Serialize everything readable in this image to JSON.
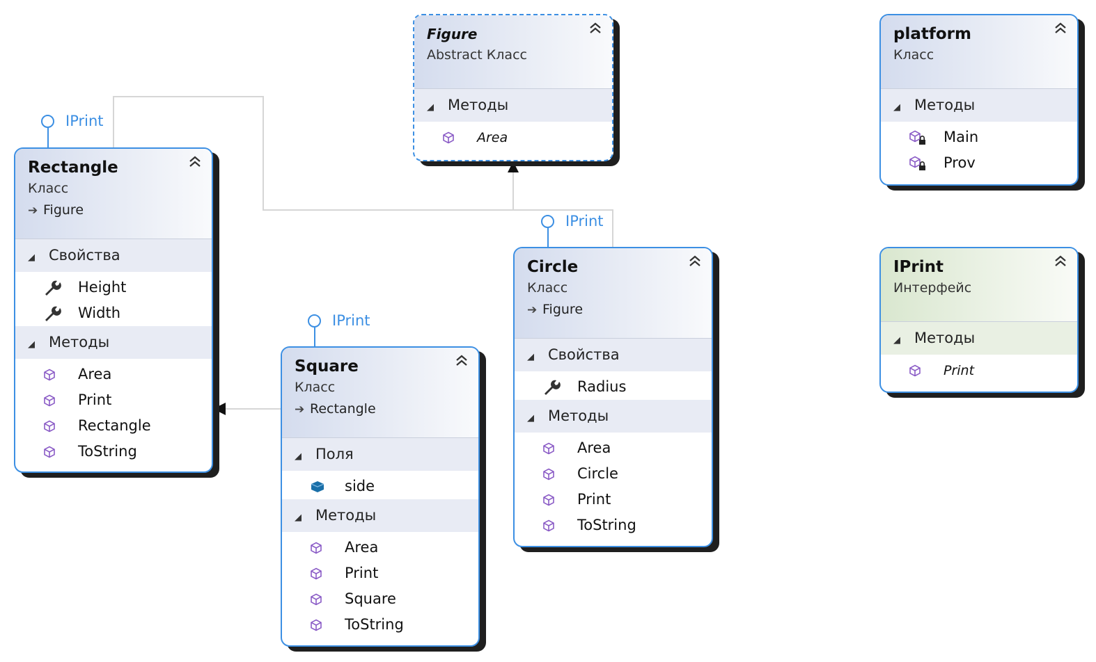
{
  "colors": {
    "accent": "#3c8fe3",
    "shadow": "#1f1f1f",
    "class_header": "#d4dcee",
    "interface_header": "#d9e7cf",
    "method_icon": "#8a5bc6",
    "field_icon": "#1a6fa8"
  },
  "lollipops": {
    "rectangle": "IPrint",
    "square": "IPrint",
    "circle": "IPrint"
  },
  "figure": {
    "name": "Figure",
    "kind": "Abstract Класс",
    "methods_label": "Методы",
    "methods": [
      "Area"
    ]
  },
  "platform": {
    "name": "platform",
    "kind": "Класс",
    "methods_label": "Методы",
    "methods": [
      "Main",
      "Prov"
    ]
  },
  "rectangle": {
    "name": "Rectangle",
    "kind": "Класс",
    "base": "Figure",
    "properties_label": "Свойства",
    "properties": [
      "Height",
      "Width"
    ],
    "methods_label": "Методы",
    "methods": [
      "Area",
      "Print",
      "Rectangle",
      "ToString"
    ]
  },
  "square": {
    "name": "Square",
    "kind": "Класс",
    "base": "Rectangle",
    "fields_label": "Поля",
    "fields": [
      "side"
    ],
    "methods_label": "Методы",
    "methods": [
      "Area",
      "Print",
      "Square",
      "ToString"
    ]
  },
  "circle": {
    "name": "Circle",
    "kind": "Класс",
    "base": "Figure",
    "properties_label": "Свойства",
    "properties": [
      "Radius"
    ],
    "methods_label": "Методы",
    "methods": [
      "Area",
      "Circle",
      "Print",
      "ToString"
    ]
  },
  "iprint": {
    "name": "IPrint",
    "kind": "Интерфейс",
    "methods_label": "Методы",
    "methods": [
      "Print"
    ]
  }
}
